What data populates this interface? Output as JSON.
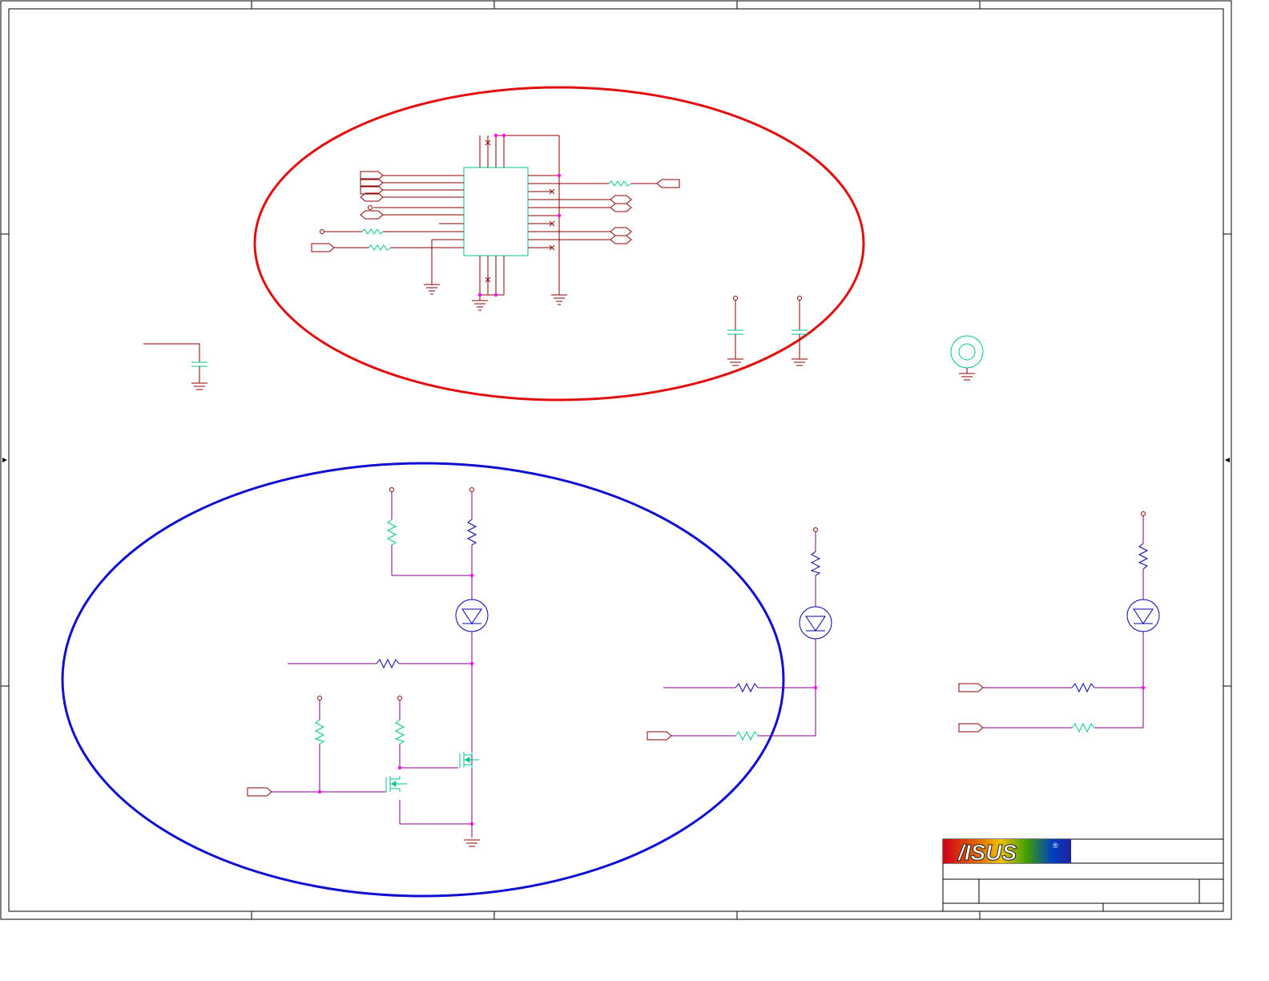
{
  "sheet": {
    "colors": {
      "frame": "#000000",
      "wire": "#8b0000",
      "wire_purple": "#800080",
      "component_green": "#00c78c",
      "diode_blue": "#0000aa",
      "junction": "#ff00ff",
      "highlight_red": "#e01010",
      "highlight_blue": "#1010d0"
    }
  },
  "title_block": {
    "logo": {
      "text": "/ISUS",
      "registered_mark": "®",
      "gradient": [
        "#d0001a",
        "#e06000",
        "#f0c000",
        "#40a000",
        "#0040c0",
        "#2020a0"
      ]
    }
  },
  "icons": {
    "mounting_hole": "mounting-hole-icon",
    "ground": "ground-icon",
    "led": "led-diode-icon",
    "mosfet": "n-mosfet-icon"
  }
}
